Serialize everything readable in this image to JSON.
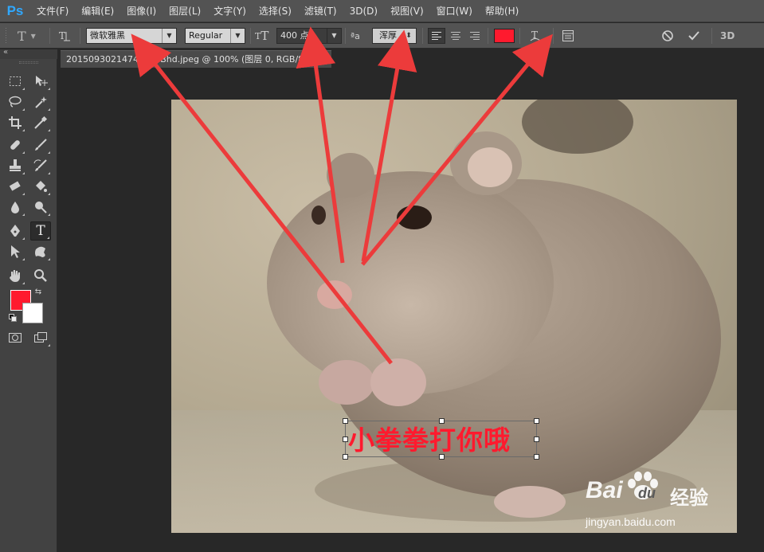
{
  "app": {
    "logo": "Ps",
    "accent": "#30a8ff"
  },
  "menu": [
    "文件(F)",
    "编辑(E)",
    "图像(I)",
    "图层(L)",
    "文字(Y)",
    "选择(S)",
    "滤镜(T)",
    "3D(D)",
    "视图(V)",
    "窗口(W)",
    "帮助(H)"
  ],
  "options": {
    "tool_icon": "type-tool-icon",
    "font_family": "微软雅黑",
    "font_style": "Regular",
    "font_size": "400 点",
    "aa_label": "ªa",
    "antialias": "浑厚",
    "text_color": "#ff1a2e",
    "threeD_label": "3D"
  },
  "document": {
    "tab_title": "20150930214745_YUBhd.jpeg @ 100% (图层 0, RGB/8#)",
    "close_label": "×",
    "canvas_text": "小拳拳打你哦"
  },
  "colors": {
    "foreground": "#ff1a2e",
    "background": "#ffffff"
  },
  "watermark": {
    "brand": "Bai",
    "brand_tail": "du",
    "cn": "经验",
    "url": "jingyan.baidu.com"
  }
}
